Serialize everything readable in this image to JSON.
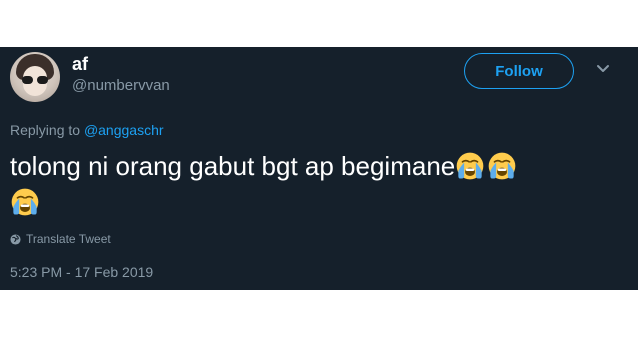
{
  "user": {
    "display_name": "af",
    "handle": "@numbervvan"
  },
  "header": {
    "follow_label": "Follow"
  },
  "reply": {
    "prefix": "Replying to",
    "mention": "@anggaschr"
  },
  "tweet": {
    "text": "tolong ni orang gabut bgt ap begimane",
    "emoji": "loudly-crying-face-icon",
    "emoji_count": 3
  },
  "actions": {
    "translate_label": "Translate Tweet"
  },
  "meta": {
    "timestamp": "5:23 PM - 17 Feb 2019"
  },
  "colors": {
    "card_background": "#15202b",
    "accent": "#1da1f2",
    "muted_text": "#8899a6",
    "primary_text": "#ffffff"
  }
}
